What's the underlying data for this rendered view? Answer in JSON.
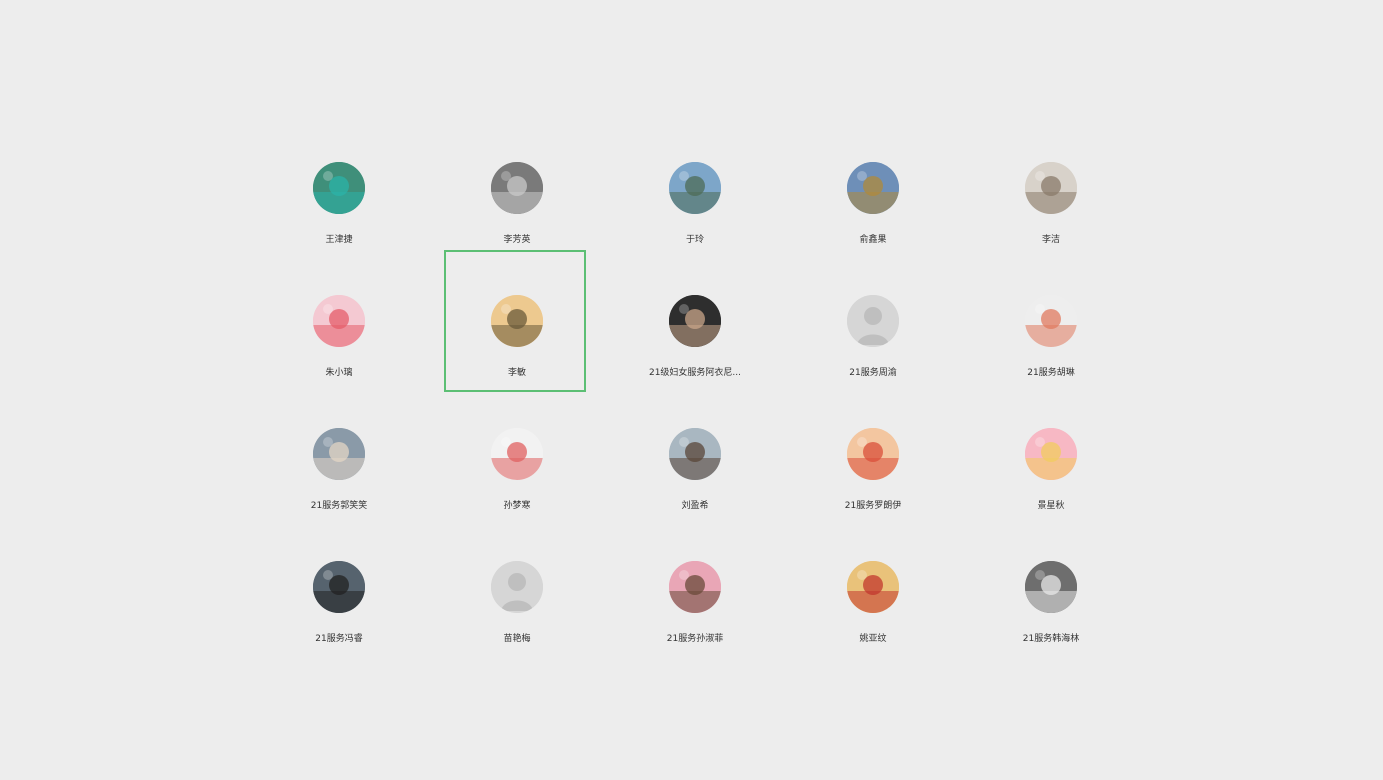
{
  "contacts": [
    {
      "name": "王津捷",
      "icon": "landscape-lagoon-avatar",
      "bg": "#3f8f7a",
      "accent": "#2bb3a8"
    },
    {
      "name": "李芳英",
      "icon": "old-street-avatar",
      "bg": "#7a7a7a",
      "accent": "#c9c9c9"
    },
    {
      "name": "于玲",
      "icon": "lake-landscape-avatar",
      "bg": "#7da6c9",
      "accent": "#4e6b55"
    },
    {
      "name": "俞鑫果",
      "icon": "tree-avatar",
      "bg": "#6e8fb8",
      "accent": "#b08a3a"
    },
    {
      "name": "李洁",
      "icon": "baby-photo-avatar",
      "bg": "#d8d2ca",
      "accent": "#8a7a6a"
    },
    {
      "name": "朱小璃",
      "icon": "cartoon-girl-avatar",
      "bg": "#f4c9d2",
      "accent": "#e65c6a"
    },
    {
      "name": "李敏",
      "icon": "ink-sketch-avatar",
      "bg": "#edc98f",
      "accent": "#6a5a3a"
    },
    {
      "name": "21级妇女服务阿衣尼...",
      "icon": "portrait-woman-avatar",
      "bg": "#2e2e2e",
      "accent": "#c9a58a"
    },
    {
      "name": "21服务周渝",
      "icon": "default-user-avatar",
      "bg": "#d6d6d6",
      "accent": "#bdbdbd"
    },
    {
      "name": "21服务胡琳",
      "icon": "tiger-hat-baby-avatar",
      "bg": "#eeeeee",
      "accent": "#e07a5f"
    },
    {
      "name": "21服务郭笑笑",
      "icon": "selfie-avatar",
      "bg": "#8a9aa8",
      "accent": "#e3d5c6"
    },
    {
      "name": "孙梦寒",
      "icon": "cartoon-clown-avatar",
      "bg": "#f2f2f2",
      "accent": "#e06060"
    },
    {
      "name": "刘盈希",
      "icon": "beach-portrait-avatar",
      "bg": "#a9b7c1",
      "accent": "#5a4638"
    },
    {
      "name": "21服务罗朗伊",
      "icon": "crayon-shin-chan-avatar",
      "bg": "#f3c6a0",
      "accent": "#d94f3a"
    },
    {
      "name": "景星秋",
      "icon": "cartoon-blonde-girl-avatar",
      "bg": "#f7b8c4",
      "accent": "#f2cc5f"
    },
    {
      "name": "21服务冯睿",
      "icon": "window-portrait-avatar",
      "bg": "#56636e",
      "accent": "#222222"
    },
    {
      "name": "苗艳梅",
      "icon": "default-user-avatar",
      "bg": "#d6d6d6",
      "accent": "#bdbdbd"
    },
    {
      "name": "21服务孙淑菲",
      "icon": "pink-girl-avatar",
      "bg": "#e9a6b6",
      "accent": "#6a4a3a"
    },
    {
      "name": "姚亚纹",
      "icon": "sunset-dance-avatar",
      "bg": "#e9c27a",
      "accent": "#c2372e"
    },
    {
      "name": "21服务韩海林",
      "icon": "cat-avatar",
      "bg": "#6e6e6e",
      "accent": "#e8e8e8"
    }
  ],
  "selected_index": 6,
  "selection_color": "#5cbf74"
}
